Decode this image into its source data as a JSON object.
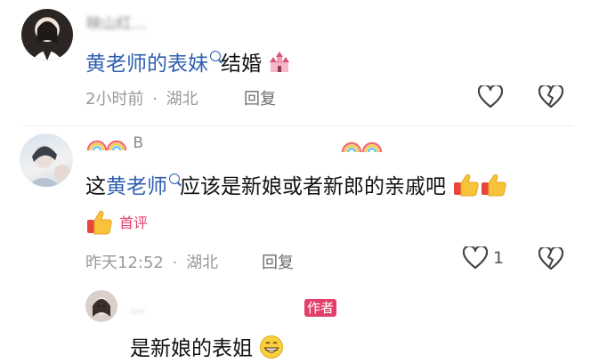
{
  "comments": [
    {
      "username": "映山红…",
      "text_parts": {
        "link": "黄老师的表妹",
        "rest": "结婚"
      },
      "time": "2小时前",
      "location": "湖北",
      "reply_label": "回复"
    },
    {
      "username": "B",
      "text_parts": {
        "prefix": "这",
        "link": "黄老师",
        "rest": "应该是新娘或者新郎的亲戚吧"
      },
      "badge": "首评",
      "time": "昨天12:52",
      "location": "湖北",
      "reply_label": "回复",
      "like_count": "1"
    }
  ],
  "reply": {
    "username": "…",
    "author_badge": "作者",
    "text": "是新娘的表姐"
  },
  "separator": "·",
  "colors": {
    "link": "#2f5fb0",
    "badge": "#e23f6a",
    "meta": "#9a9a9a"
  },
  "icons": [
    "heart-outline-icon",
    "broken-heart-icon",
    "search-link-icon",
    "wedding-castle-emoji",
    "thumbs-up-emoji",
    "rainbow-emoji",
    "grin-emoji"
  ]
}
